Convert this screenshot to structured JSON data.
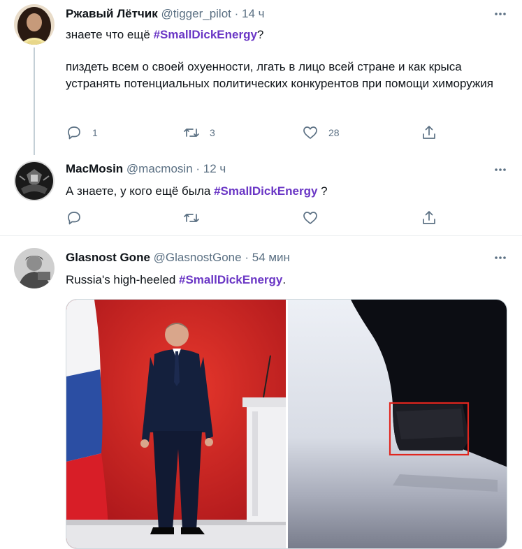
{
  "tweets": [
    {
      "author_name": "Ржавый Лётчик",
      "handle": "@tigger_pilot",
      "separator": "·",
      "time": "14 ч",
      "text_line1_before": "знаете что ещё ",
      "text_line1_hashtag": "#SmallDickEnergy",
      "text_line1_after": "?",
      "text_para2": "пиздеть всем о своей охуенности, лгать в лицо всей стране и как крыса устранять потенциальных политических конкурентов при помощи химоружия",
      "replies": "1",
      "retweets": "3",
      "likes": "28"
    },
    {
      "author_name": "MacMosin",
      "handle": "@macmosin",
      "separator": "·",
      "time": "12 ч",
      "text_before": "А знаете, у кого ещё была ",
      "text_hashtag": "#SmallDickEnergy",
      "text_after": " ?"
    },
    {
      "author_name": "Glasnost Gone",
      "handle": "@GlasnostGone",
      "separator": "·",
      "time": "54 мин",
      "text_before": "Russia's high-heeled ",
      "text_hashtag": "#SmallDickEnergy",
      "text_after": "."
    }
  ],
  "icons": {
    "reply": "reply-icon",
    "retweet": "retweet-icon",
    "like": "heart-icon",
    "share": "share-icon",
    "more": "more-icon"
  },
  "colors": {
    "hashtag": "#6a36c5",
    "secondary_text": "#5b7083",
    "icon": "#5b7083",
    "thread_line": "#c4cfd6",
    "divider": "#ebeef0"
  }
}
